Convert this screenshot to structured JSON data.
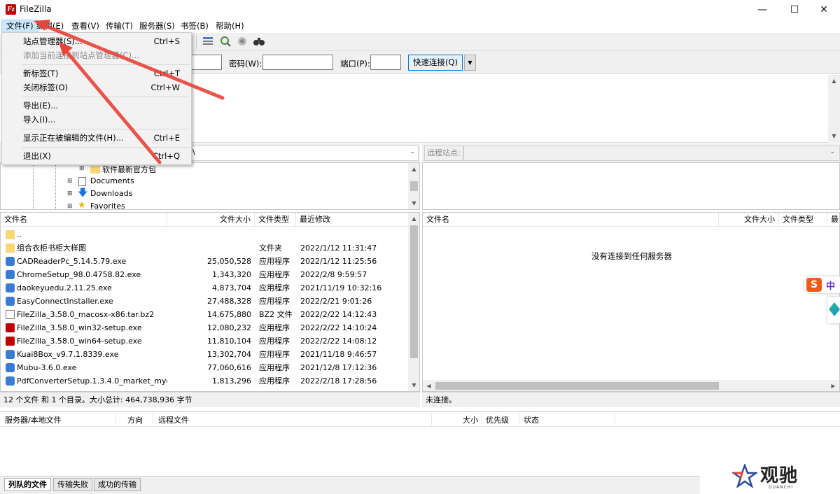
{
  "window": {
    "title": "FileZilla",
    "app_icon": "Fz"
  },
  "menubar": [
    "文件(F)",
    "编辑(E)",
    "查看(V)",
    "传输(T)",
    "服务器(S)",
    "书签(B)",
    "帮助(H)"
  ],
  "file_menu": {
    "items": [
      {
        "label": "站点管理器(S)...",
        "shortcut": "Ctrl+S"
      },
      {
        "label": "添加当前连接到站点管理器(C)...",
        "shortcut": ""
      },
      {
        "label": "新标签(T)",
        "shortcut": "Ctrl+T"
      },
      {
        "label": "关闭标签(O)",
        "shortcut": "Ctrl+W"
      },
      {
        "label": "导出(E)...",
        "shortcut": ""
      },
      {
        "label": "导入(I)...",
        "shortcut": ""
      },
      {
        "label": "显示正在被编辑的文件(H)...",
        "shortcut": "Ctrl+E"
      },
      {
        "label": "退出(X)",
        "shortcut": "Ctrl+Q"
      }
    ]
  },
  "quickconnect": {
    "password_label": "密码(W):",
    "port_label": "端口(P):",
    "connect_button": "快速连接(Q)"
  },
  "local": {
    "path_tail": "\\",
    "tree": [
      {
        "label": "软件最新官方包"
      },
      {
        "label": "Documents"
      },
      {
        "label": "Downloads"
      },
      {
        "label": "Favorites"
      }
    ],
    "columns": [
      "文件名",
      "文件大小",
      "文件类型",
      "最近修改"
    ],
    "files": [
      {
        "name": "..",
        "size": "",
        "type": "",
        "modified": ""
      },
      {
        "name": "组合衣柜书柜大样图",
        "size": "",
        "type": "文件夹",
        "modified": "2022/1/12 11:31:47"
      },
      {
        "name": "CADReaderPc_5.14.5.79.exe",
        "size": "25,050,528",
        "type": "应用程序",
        "modified": "2022/1/12 11:25:56"
      },
      {
        "name": "ChromeSetup_98.0.4758.82.exe",
        "size": "1,343,320",
        "type": "应用程序",
        "modified": "2022/2/8 9:59:57"
      },
      {
        "name": "daokeyuedu.2.11.25.exe",
        "size": "4,873,704",
        "type": "应用程序",
        "modified": "2021/11/19 10:32:16"
      },
      {
        "name": "EasyConnectInstaller.exe",
        "size": "27,488,328",
        "type": "应用程序",
        "modified": "2022/2/21 9:01:26"
      },
      {
        "name": "FileZilla_3.58.0_macosx-x86.tar.bz2",
        "size": "14,675,880",
        "type": "BZ2 文件",
        "modified": "2022/2/22 14:12:43"
      },
      {
        "name": "FileZilla_3.58.0_win32-setup.exe",
        "size": "12,080,232",
        "type": "应用程序",
        "modified": "2022/2/22 14:10:24"
      },
      {
        "name": "FileZilla_3.58.0_win64-setup.exe",
        "size": "11,810,104",
        "type": "应用程序",
        "modified": "2022/2/22 14:08:12"
      },
      {
        "name": "Kuai8Box_v9.7.1.8339.exe",
        "size": "13,302,704",
        "type": "应用程序",
        "modified": "2021/11/18 9:46:57"
      },
      {
        "name": "Mubu-3.6.0.exe",
        "size": "77,060,616",
        "type": "应用程序",
        "modified": "2021/12/8 17:12:36"
      },
      {
        "name": "PdfConverterSetup.1.3.4.0_market_myd...",
        "size": "1,813,296",
        "type": "应用程序",
        "modified": "2022/2/18 17:28:56"
      }
    ],
    "status": "12 个文件 和 1 个目录。大小总计: 464,738,936 字节"
  },
  "remote": {
    "site_label": "远程站点:",
    "columns": [
      "文件名",
      "文件大小",
      "文件类型",
      "最"
    ],
    "empty_message": "没有连接到任何服务器",
    "status": "未连接。"
  },
  "queue": {
    "columns": [
      "服务器/本地文件",
      "方向",
      "远程文件",
      "大小",
      "优先级",
      "状态"
    ],
    "tabs": [
      "列队的文件",
      "传输失败",
      "成功的传输"
    ]
  },
  "side_widget": {
    "ime_char": "中"
  },
  "watermark": {
    "cn": "观驰",
    "en": "GUANCHI"
  },
  "colors": {
    "arrow": "#e8443a",
    "menu_highlight": "#cce8ff",
    "fz_red": "#bf0000"
  }
}
